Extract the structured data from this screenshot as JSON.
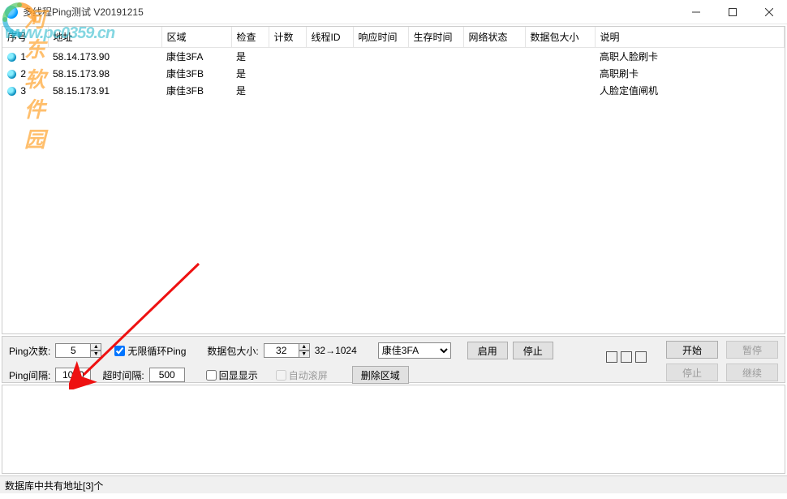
{
  "window": {
    "title": "多线程Ping测试 V20191215"
  },
  "watermark": {
    "cn": "河东软件园",
    "url": "www.pc0359.cn"
  },
  "table": {
    "headers": [
      "序号",
      "地址",
      "区域",
      "检查",
      "计数",
      "线程ID",
      "响应时间",
      "生存时间",
      "网络状态",
      "数据包大小",
      "说明"
    ],
    "rows": [
      {
        "seq": "1",
        "addr": "58.14.173.90",
        "zone": "康佳3FA",
        "check": "是",
        "desc": "高职人脸刷卡"
      },
      {
        "seq": "2",
        "addr": "58.15.173.98",
        "zone": "康佳3FB",
        "check": "是",
        "desc": "高职刷卡"
      },
      {
        "seq": "3",
        "addr": "58.15.173.91",
        "zone": "康佳3FB",
        "check": "是",
        "desc": "人脸定值闸机"
      }
    ]
  },
  "controls": {
    "pingCount_label": "Ping次数:",
    "pingCount_value": "5",
    "infiniteLoop_label": "无限循环Ping",
    "packetSize_label": "数据包大小:",
    "packetSize_value": "32",
    "packetSize_range": "32→1024",
    "zone_selected": "康佳3FA",
    "enable_btn": "启用",
    "stop_btn": "停止",
    "pingInterval_label": "Ping间隔:",
    "pingInterval_value": "1000",
    "timeoutInterval_label": "超时间隔:",
    "timeoutInterval_value": "500",
    "echoDisplay_label": "回显显示",
    "autoScroll_label": "自动滚屏",
    "deleteZone_btn": "删除区域",
    "start_btn": "开始",
    "pause_btn": "暂停",
    "stop2_btn": "停止",
    "continue_btn": "继续"
  },
  "statusbar": {
    "text": "数据库中共有地址[3]个"
  }
}
